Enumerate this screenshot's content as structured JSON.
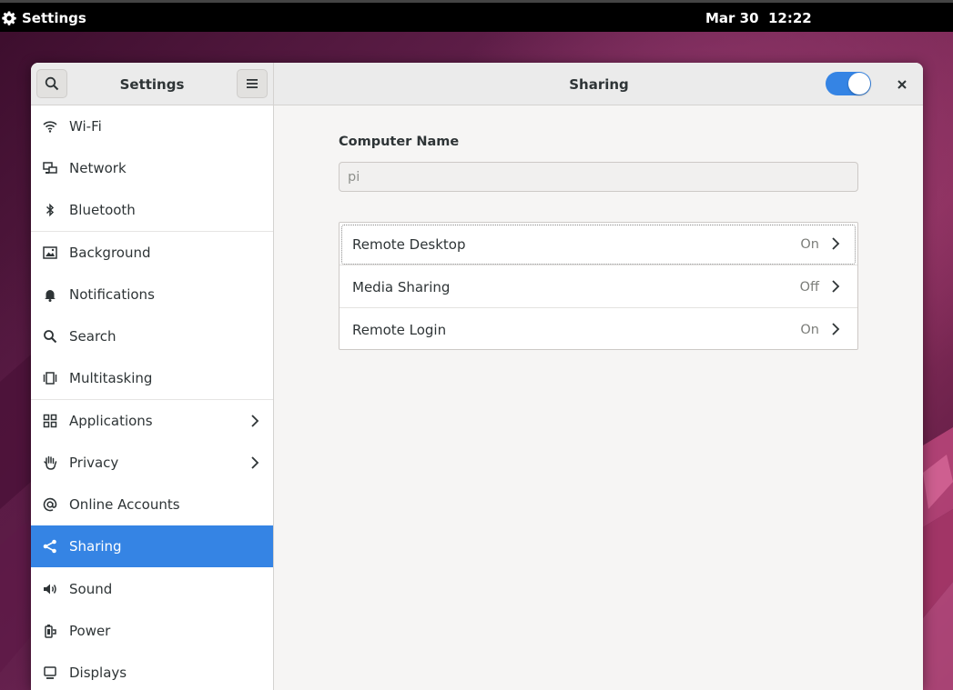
{
  "topbar": {
    "app_name": "Settings",
    "clock": "Mar 30  12:22"
  },
  "window": {
    "sidebar_title": "Settings",
    "page_title": "Sharing",
    "sharing_enabled": true
  },
  "sidebar": {
    "items": [
      {
        "label": "Wi-Fi",
        "icon": "wifi-icon"
      },
      {
        "label": "Network",
        "icon": "network-icon"
      },
      {
        "label": "Bluetooth",
        "icon": "bluetooth-icon"
      },
      {
        "label": "Background",
        "icon": "background-icon"
      },
      {
        "label": "Notifications",
        "icon": "bell-icon"
      },
      {
        "label": "Search",
        "icon": "search-icon"
      },
      {
        "label": "Multitasking",
        "icon": "multitasking-icon"
      },
      {
        "label": "Applications",
        "icon": "applications-icon"
      },
      {
        "label": "Privacy",
        "icon": "hand-icon"
      },
      {
        "label": "Online Accounts",
        "icon": "at-icon"
      },
      {
        "label": "Sharing",
        "icon": "share-icon"
      },
      {
        "label": "Sound",
        "icon": "speaker-icon"
      },
      {
        "label": "Power",
        "icon": "power-icon"
      },
      {
        "label": "Displays",
        "icon": "display-icon"
      }
    ],
    "active": "Sharing"
  },
  "content": {
    "computer_name_label": "Computer Name",
    "computer_name_value": "pi",
    "rows": [
      {
        "label": "Remote Desktop",
        "state": "On"
      },
      {
        "label": "Media Sharing",
        "state": "Off"
      },
      {
        "label": "Remote Login",
        "state": "On"
      }
    ]
  },
  "colors": {
    "accent": "#3584e4",
    "topbar": "#000000",
    "window_bg": "#f6f5f4"
  }
}
